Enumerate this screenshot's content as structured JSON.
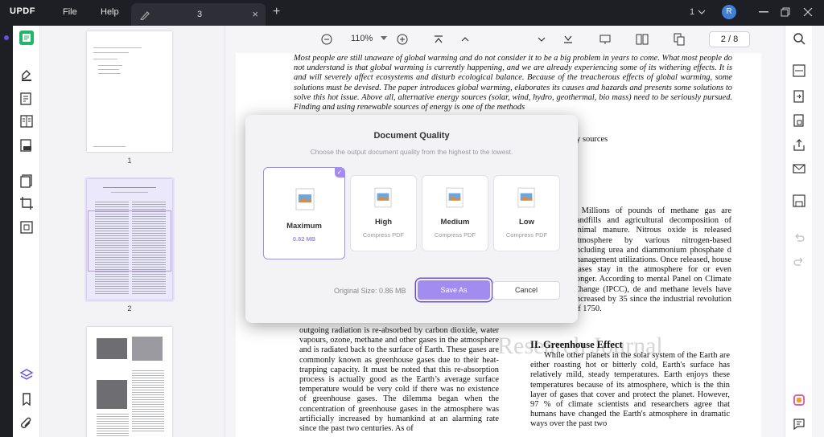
{
  "titlebar": {
    "logo": "UPDF",
    "menu_file": "File",
    "menu_help": "Help",
    "tab_number": "3",
    "tab_close": "×",
    "new_tab": "+",
    "page_count": "1",
    "avatar_initial": "R"
  },
  "thumbnails": [
    {
      "label": "1"
    },
    {
      "label": "2"
    },
    {
      "label": ""
    }
  ],
  "toolbar": {
    "zoom": "110%",
    "page_current": "2",
    "page_total": "8",
    "page_separator": "/"
  },
  "document": {
    "paragraph_top": "Most people are still unaware of global warming and do not consider it to be a big problem in years to come. What most people do not understand is that global warming is currently happening, and we are already experiencing some of its withering effects. It is and will severely affect ecosystems and disturb ecological balance. Because of the treacherous effects of global warming, some solutions must be devised. The paper introduces global warming, elaborates its causes and hazards and presents some solutions to solve this hot issue. Above all, alternative energy sources (solar, wind, hydro, geothermal, bio mass) need to be seriously pursued. Finding and using renewable sources of energy is one of the methods",
    "fragment_energy": "gy sources",
    "right_col_top": ". Millions of pounds of methane gas are landfills and agricultural decomposition of animal manure. Nitrous oxide is released atmosphere by various nitrogen-based including urea and diammonium phosphate d management utilizations. Once released, house gases stay in the atmosphere for or even longer. According to mental Panel on Climate Change (IPCC), de and methane levels have increased by 35 since the industrial revolution of 1750.",
    "left_col_bottom": "outgoing radiation is re-absorbed by carbon dioxide, water vapours, ozone, methane and other gases in the atmosphere and is radiated back to the surface of Earth. These gases are commonly known as greenhouse gases due to their heat-trapping capacity. It must be noted that this re-absorption process is actually good as the Earth’s average surface temperature would be very cold if there was no existence of greenhouse gases. The dilemma began when the concentration of greenhouse gases in the atmosphere was artificially increased by humankind at an alarming rate since the past two centuries. As of",
    "heading": "II. Greenhouse Effect",
    "right_col_bottom": "While other planets in the solar system of the Earth are either roasting hot or bitterly cold, Earth's surface has relatively mild, steady temperatures. Earth enjoys these temperatures because of its atmosphere, which is the thin layer of gases that cover and protect the planet. However, 97 % of climate scientists and researchers agree that humans have changed the Earth's atmosphere in dramatic ways over the past two",
    "watermark": "Research Journal"
  },
  "modal": {
    "title": "Document Quality",
    "subtitle": "Choose the output document quality from the highest to the lowest.",
    "options": [
      {
        "name": "Maximum",
        "desc": "0.82 MB"
      },
      {
        "name": "High",
        "desc": "Compress PDF"
      },
      {
        "name": "Medium",
        "desc": "Compress PDF"
      },
      {
        "name": "Low",
        "desc": "Compress PDF"
      }
    ],
    "original_size": "Original Size: 0.86 MB",
    "save_as": "Save As",
    "cancel": "Cancel"
  },
  "colors": {
    "accent": "#a38cf0",
    "accent_dark": "#6b4fe0",
    "titlebar": "#1e1f24"
  }
}
